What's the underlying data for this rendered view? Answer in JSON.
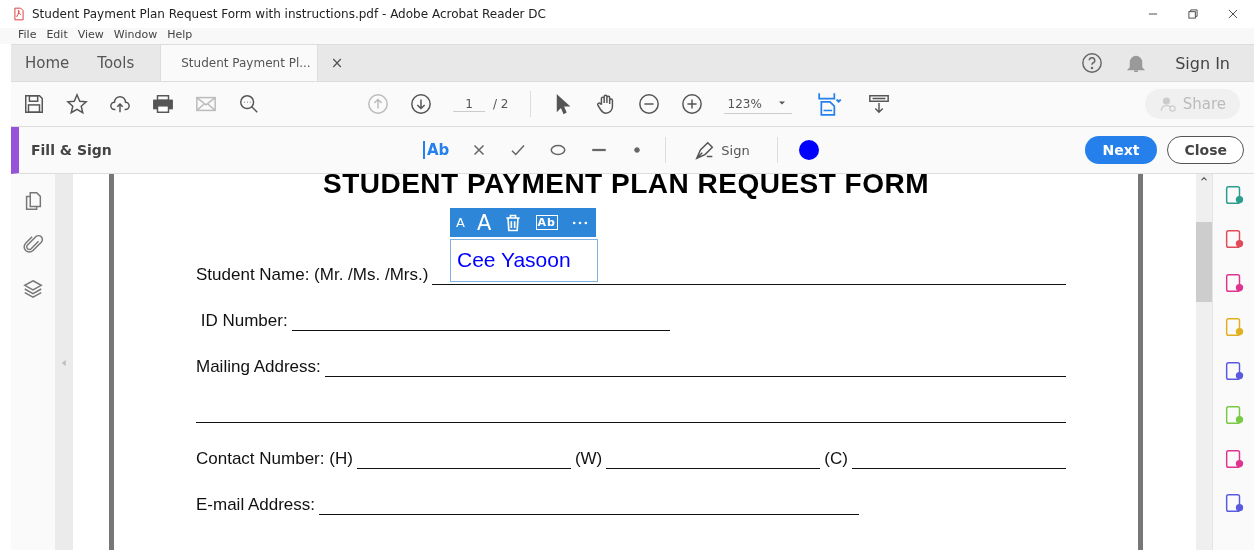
{
  "window": {
    "title": "Student Payment Plan Request Form with instructions.pdf - Adobe Acrobat Reader DC"
  },
  "menu": [
    "File",
    "Edit",
    "View",
    "Window",
    "Help"
  ],
  "tabs": [
    {
      "label": "Home",
      "selected": false
    },
    {
      "label": "Tools",
      "selected": false
    },
    {
      "label": "Student Payment Pl...",
      "selected": true,
      "close_glyph": "×"
    }
  ],
  "sign_in": "Sign In",
  "toolbar": {
    "page": "1",
    "page_total": "/ 2",
    "zoom": "123%",
    "share": "Share"
  },
  "fill_sign": {
    "title": "Fill & Sign",
    "add_text": "Ab",
    "sign": "Sign",
    "color": "#0000ff",
    "next": "Next",
    "close": "Close"
  },
  "document": {
    "title": "STUDENT PAYMENT PLAN REQUEST FORM",
    "rows": [
      {
        "parts": [
          {
            "kind": "text",
            "text": "Student Name: (Mr. /Ms. /Mrs.)"
          },
          {
            "kind": "line"
          }
        ]
      },
      {
        "parts": [
          {
            "kind": "text",
            "text": " ID Number:"
          },
          {
            "kind": "line",
            "short": true
          }
        ]
      },
      {
        "parts": [
          {
            "kind": "text",
            "text": "Mailing Address:"
          },
          {
            "kind": "line"
          }
        ]
      },
      {
        "parts": [
          {
            "kind": "line"
          }
        ]
      },
      {
        "parts": [
          {
            "kind": "text",
            "text": "Contact Number: (H)"
          },
          {
            "kind": "line"
          },
          {
            "kind": "text",
            "text": "(W)"
          },
          {
            "kind": "line"
          },
          {
            "kind": "text",
            "text": "(C)"
          },
          {
            "kind": "line"
          }
        ]
      },
      {
        "parts": [
          {
            "kind": "text",
            "text": "E-mail Address:"
          },
          {
            "kind": "line",
            "short": true
          }
        ]
      }
    ],
    "text_box": {
      "value": "Cee Yasoon",
      "smaller": "A",
      "larger": "A",
      "field_text": "Ab"
    }
  }
}
